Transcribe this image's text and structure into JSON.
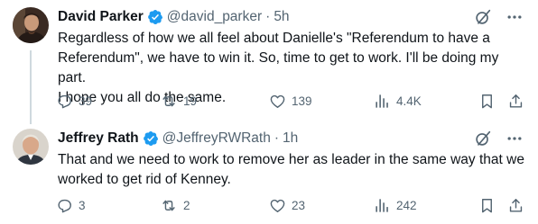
{
  "colors": {
    "verified": "#1d9bf0",
    "text": "#0f1419",
    "muted": "#536471",
    "thread_line": "#cfd9de"
  },
  "icons": [
    "verified-badge-icon",
    "grok-icon",
    "more-icon",
    "reply-icon",
    "retweet-icon",
    "like-icon",
    "views-icon",
    "bookmark-icon",
    "share-icon"
  ],
  "tweets": [
    {
      "name": "David Parker",
      "handle": "@david_parker",
      "separator": "·",
      "time": "5h",
      "lines": [
        "Regardless of how we all feel about Danielle's \"Referendum to have a",
        "Referendum\", we have to win it. So, time to get to work. I'll be doing my part.",
        "I hope you all do the same."
      ],
      "replies": "39",
      "retweets": "19",
      "likes": "139",
      "views": "4.4K"
    },
    {
      "name": "Jeffrey Rath",
      "handle": "@JeffreyRWRath",
      "separator": "·",
      "time": "1h",
      "lines": [
        "That and we need to work to remove her as leader in the same way that we",
        "worked to get rid of Kenney."
      ],
      "replies": "3",
      "retweets": "2",
      "likes": "23",
      "views": "242"
    }
  ]
}
